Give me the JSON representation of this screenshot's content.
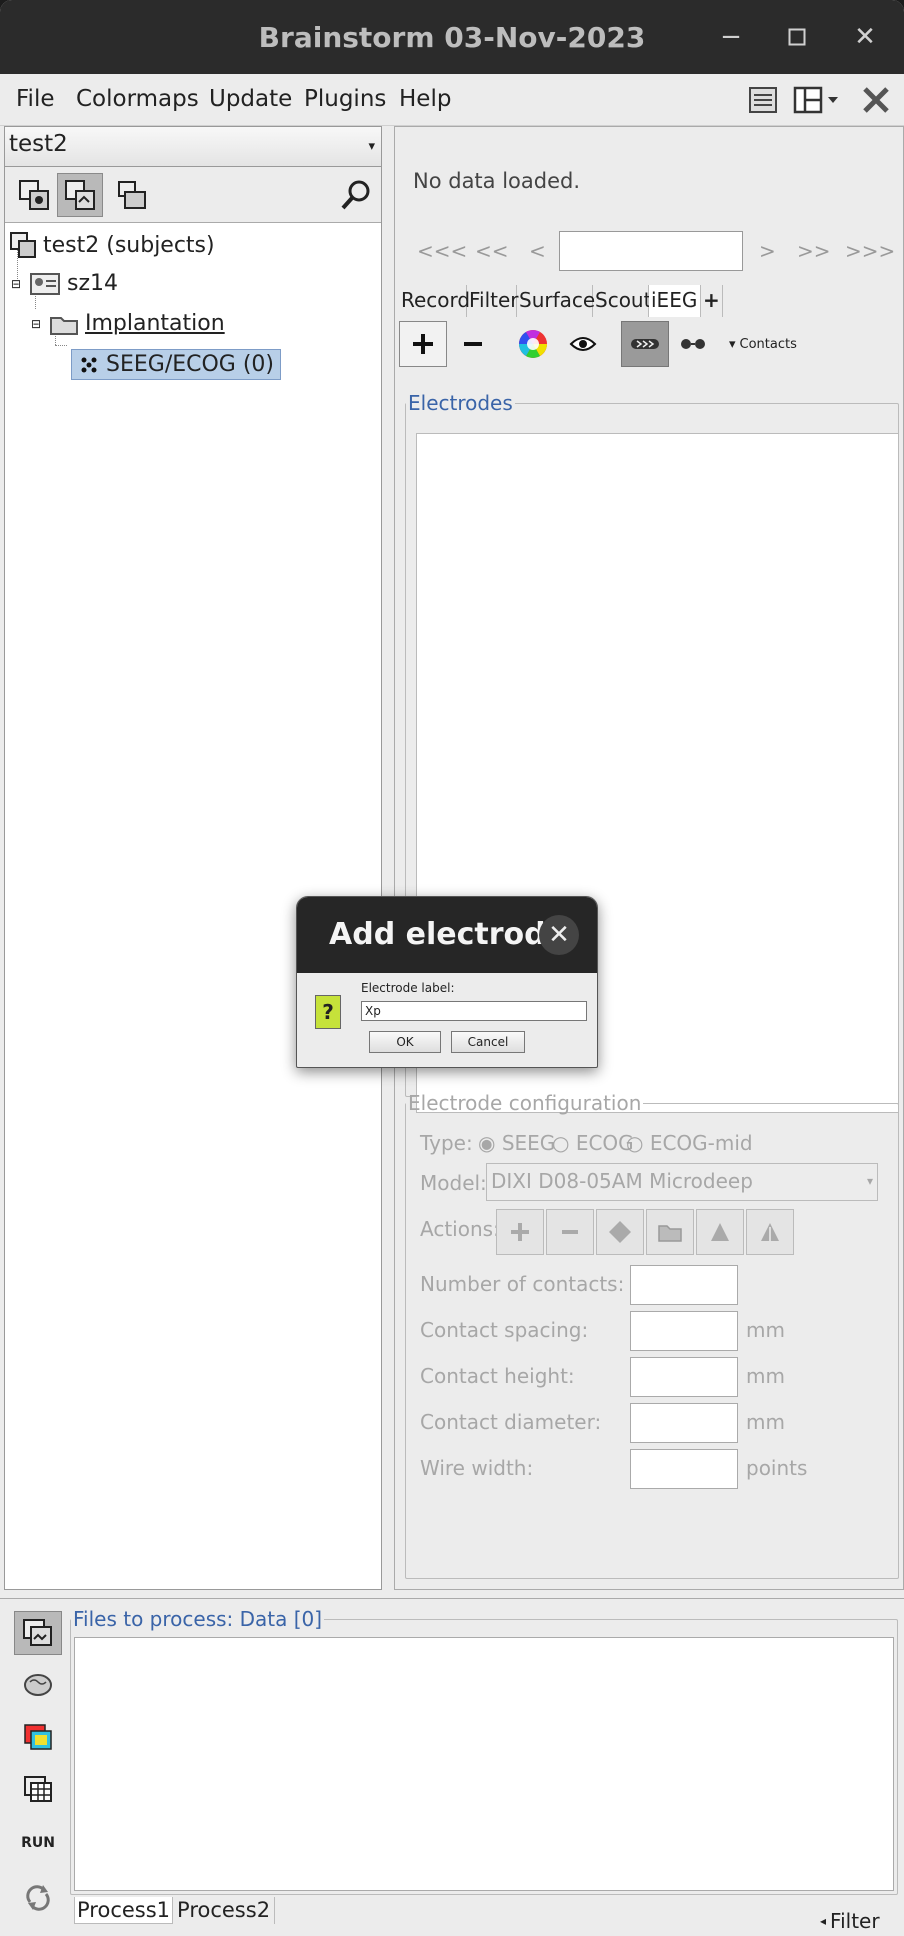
{
  "window": {
    "title": "Brainstorm 03-Nov-2023"
  },
  "menu": [
    "File",
    "Colormaps",
    "Update",
    "Plugins",
    "Help"
  ],
  "left": {
    "protocol": "test2",
    "tree": {
      "root": "test2 (subjects)",
      "subject": "sz14",
      "folder": "Implantation",
      "item": "SEEG/ECOG (0)"
    }
  },
  "right": {
    "status": "No data loaded.",
    "nav": [
      "<<<",
      "<<",
      "<",
      ">",
      ">>",
      ">>>"
    ],
    "tabs": [
      "Record",
      "Filter",
      "Surface",
      "Scout",
      "iEEG",
      "+"
    ],
    "contacts_label": "Contacts",
    "electrodes_title": "Electrodes",
    "config": {
      "title": "Electrode configuration",
      "type_label": "Type:",
      "type_options": [
        "SEEG",
        "ECOG",
        "ECOG-mid"
      ],
      "model_label": "Model:",
      "model_value": "DIXI D08-05AM Microdeep",
      "actions_label": "Actions:",
      "fields": [
        {
          "label": "Number of contacts:",
          "unit": ""
        },
        {
          "label": "Contact spacing:",
          "unit": "mm"
        },
        {
          "label": "Contact height:",
          "unit": "mm"
        },
        {
          "label": "Contact diameter:",
          "unit": "mm"
        },
        {
          "label": "Wire width:",
          "unit": "points"
        }
      ]
    }
  },
  "bottom": {
    "files_title": "Files to process: Data [0]",
    "run_label": "RUN",
    "tabs": [
      "Process1",
      "Process2"
    ],
    "filter_label": "Filter"
  },
  "dialog": {
    "title": "Add electrode",
    "label": "Electrode label:",
    "value": "Xp",
    "ok": "OK",
    "cancel": "Cancel"
  }
}
